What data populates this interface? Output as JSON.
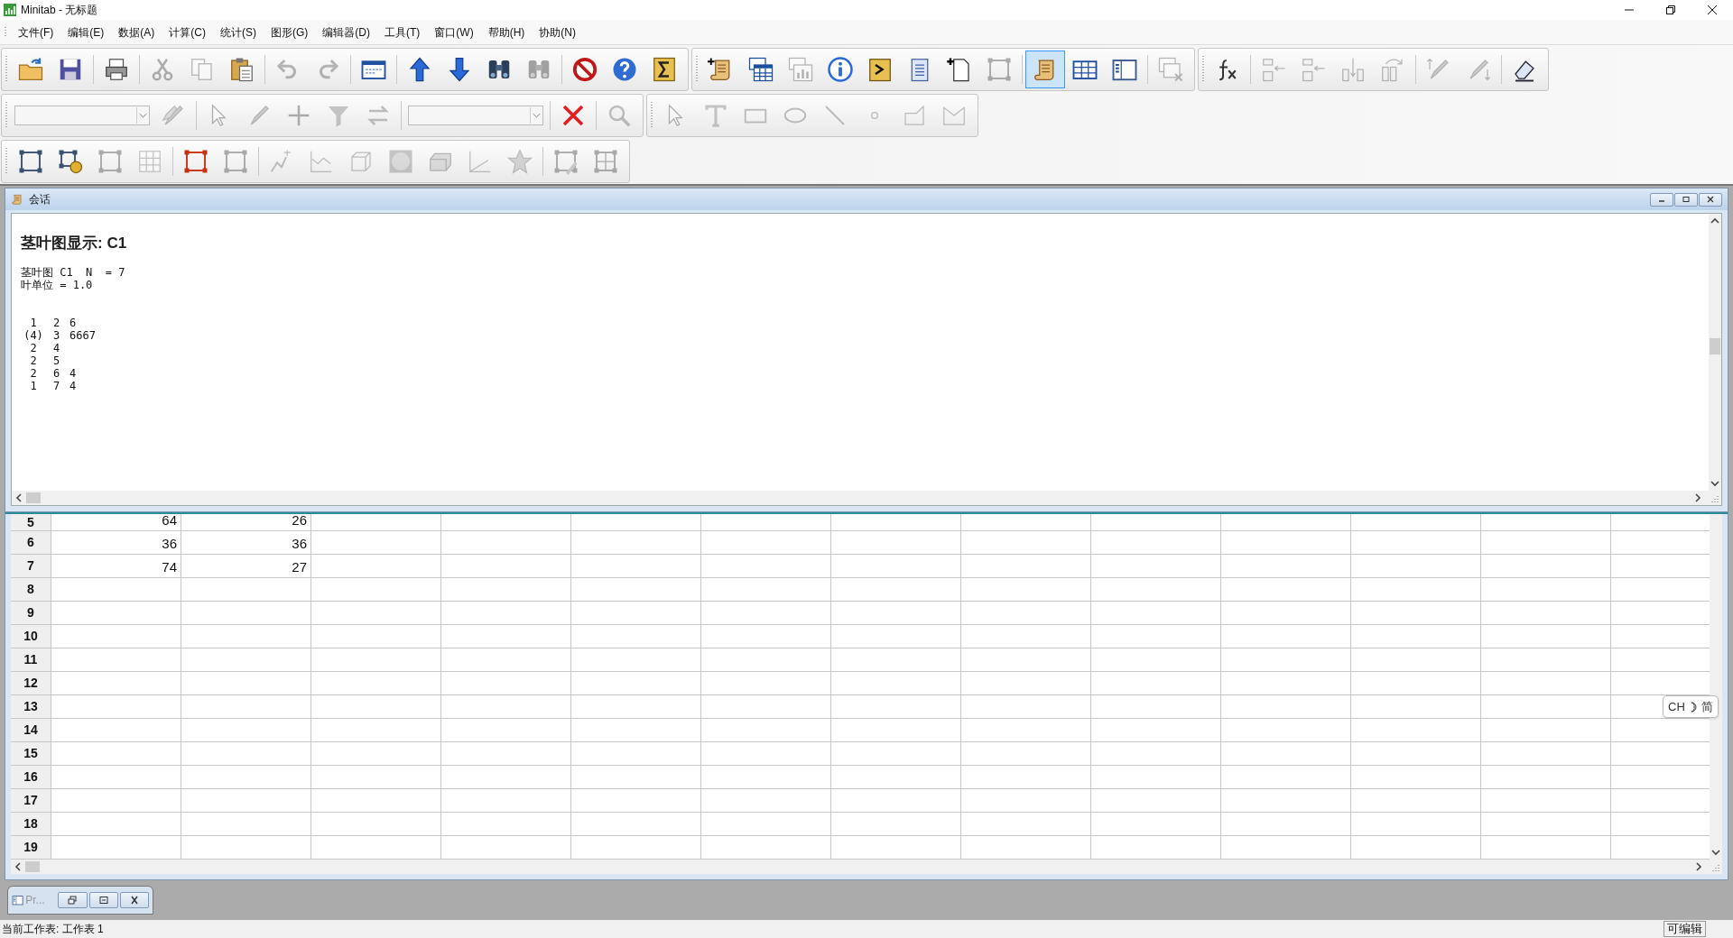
{
  "window": {
    "title": "Minitab - 无标题"
  },
  "menu": [
    "文件(F)",
    "编辑(E)",
    "数据(A)",
    "计算(C)",
    "统计(S)",
    "图形(G)",
    "编辑器(D)",
    "工具(T)",
    "窗口(W)",
    "帮助(H)",
    "协助(N)"
  ],
  "toolbar_rows": [
    [
      {
        "sections": [
          [
            {
              "kind": "folder",
              "disabled": false,
              "on": false
            },
            {
              "kind": "floppy",
              "disabled": false,
              "on": false
            }
          ],
          [
            {
              "kind": "printer",
              "disabled": false,
              "on": false
            }
          ],
          [
            {
              "kind": "scissors",
              "disabled": true,
              "on": false
            },
            {
              "kind": "copy",
              "disabled": true,
              "on": false
            },
            {
              "kind": "clipboard",
              "disabled": false,
              "on": false
            }
          ],
          [
            {
              "kind": "undo",
              "disabled": true,
              "on": false
            },
            {
              "kind": "redo",
              "disabled": true,
              "on": false
            }
          ],
          [
            {
              "kind": "dialog",
              "disabled": false,
              "on": false
            }
          ],
          [
            {
              "kind": "uparrow",
              "disabled": false,
              "on": false
            },
            {
              "kind": "downarrow",
              "disabled": false,
              "on": false
            },
            {
              "kind": "binoculars",
              "disabled": false,
              "on": false
            },
            {
              "kind": "binoculars",
              "disabled": true,
              "on": false
            }
          ],
          [
            {
              "kind": "prohibition",
              "disabled": false,
              "on": false
            },
            {
              "kind": "help",
              "disabled": false,
              "on": false
            },
            {
              "kind": "sigma",
              "disabled": false,
              "on": false
            }
          ]
        ]
      },
      {
        "sections": [
          [
            {
              "kind": "scrollplus",
              "disabled": false,
              "on": false
            },
            {
              "kind": "windowstable",
              "disabled": false,
              "on": false
            },
            {
              "kind": "windowschart",
              "disabled": true,
              "on": false
            },
            {
              "kind": "info",
              "disabled": false,
              "on": false
            },
            {
              "kind": "prompt",
              "disabled": false,
              "on": false
            },
            {
              "kind": "notepad",
              "disabled": false,
              "on": false
            },
            {
              "kind": "newpage",
              "disabled": false,
              "on": false
            },
            {
              "kind": "frame",
              "disabled": true,
              "on": false
            }
          ],
          [
            {
              "kind": "scroll",
              "disabled": false,
              "on": true
            },
            {
              "kind": "table",
              "disabled": false,
              "on": false
            },
            {
              "kind": "panel",
              "disabled": false,
              "on": false
            }
          ],
          [
            {
              "kind": "windowsclose",
              "disabled": true,
              "on": false
            }
          ]
        ]
      },
      {
        "sections": [
          [
            {
              "kind": "function",
              "disabled": false,
              "on": false
            }
          ],
          [
            {
              "kind": "rowinsert",
              "disabled": true,
              "on": false
            },
            {
              "kind": "rowinsert",
              "disabled": true,
              "on": false
            },
            {
              "kind": "columninsert",
              "disabled": true,
              "on": false
            },
            {
              "kind": "columnmove",
              "disabled": true,
              "on": false
            }
          ],
          [
            {
              "kind": "brushup",
              "disabled": true,
              "on": false
            },
            {
              "kind": "brushdown",
              "disabled": true,
              "on": false
            }
          ],
          [
            {
              "kind": "eraser",
              "disabled": false,
              "on": false
            }
          ]
        ]
      }
    ],
    [
      {
        "sections": [
          [
            {
              "kind": "combo",
              "disabled": true
            },
            {
              "kind": "brushes",
              "disabled": true,
              "on": false
            }
          ],
          [
            {
              "kind": "cursor",
              "disabled": true,
              "on": false
            },
            {
              "kind": "brush",
              "disabled": true,
              "on": false
            },
            {
              "kind": "crosshair",
              "disabled": true,
              "on": false
            },
            {
              "kind": "funnel",
              "disabled": true,
              "on": false
            },
            {
              "kind": "swap",
              "disabled": true,
              "on": false
            }
          ],
          [
            {
              "kind": "combo",
              "disabled": true
            }
          ],
          [
            {
              "kind": "cross",
              "disabled": false,
              "on": false
            }
          ],
          [
            {
              "kind": "magnifier",
              "disabled": true,
              "on": false
            }
          ]
        ]
      },
      {
        "sections": [
          [
            {
              "kind": "cursor",
              "disabled": true,
              "on": false
            },
            {
              "kind": "texttool",
              "disabled": true,
              "on": false
            },
            {
              "kind": "rectangle",
              "disabled": true,
              "on": false
            },
            {
              "kind": "ellipse",
              "disabled": true,
              "on": false
            },
            {
              "kind": "line",
              "disabled": true,
              "on": false
            },
            {
              "kind": "dot",
              "disabled": true,
              "on": false
            },
            {
              "kind": "polyline",
              "disabled": true,
              "on": false
            },
            {
              "kind": "polygon",
              "disabled": true,
              "on": false
            }
          ]
        ]
      }
    ],
    [
      {
        "sections": [
          [
            {
              "kind": "frame",
              "disabled": false,
              "on": false
            },
            {
              "kind": "frameplus",
              "disabled": false,
              "on": false
            },
            {
              "kind": "frame",
              "disabled": true,
              "on": false
            },
            {
              "kind": "grid",
              "disabled": true,
              "on": false
            }
          ],
          [
            {
              "kind": "redframe",
              "disabled": false,
              "on": false
            },
            {
              "kind": "frame",
              "disabled": true,
              "on": false
            }
          ],
          [
            {
              "kind": "chartedit",
              "disabled": true,
              "on": false
            },
            {
              "kind": "linechart",
              "disabled": true,
              "on": false
            },
            {
              "kind": "cube",
              "disabled": true,
              "on": false
            },
            {
              "kind": "sphere",
              "disabled": true,
              "on": false
            },
            {
              "kind": "box3d",
              "disabled": true,
              "on": false
            },
            {
              "kind": "axes",
              "disabled": true,
              "on": false
            },
            {
              "kind": "star",
              "disabled": true,
              "on": false
            }
          ],
          [
            {
              "kind": "framebrush",
              "disabled": true,
              "on": false
            },
            {
              "kind": "framegrid",
              "disabled": true,
              "on": false
            }
          ]
        ]
      }
    ]
  ],
  "session": {
    "title": "会话",
    "heading": "茎叶图显示: C1",
    "summary_lines": [
      "茎叶图 C1  N  = 7",
      "叶单位 = 1.0"
    ],
    "stem_leaf_rows": [
      {
        "count": "1",
        "stem": "2",
        "leaves": "6"
      },
      {
        "count": "(4)",
        "stem": "3",
        "leaves": "6667"
      },
      {
        "count": "2",
        "stem": "4"
      },
      {
        "count": "2",
        "stem": "5"
      },
      {
        "count": "2",
        "stem": "6",
        "leaves": "4"
      },
      {
        "count": "1",
        "stem": "7",
        "leaves": "4"
      }
    ]
  },
  "worksheet": {
    "rows": [
      {
        "row": "5",
        "cells": [
          "64",
          "26"
        ]
      },
      {
        "row": "6",
        "cells": [
          "36",
          "36"
        ]
      },
      {
        "row": "7",
        "cells": [
          "74",
          "27"
        ]
      },
      {
        "row": "8"
      },
      {
        "row": "9"
      },
      {
        "row": "10"
      },
      {
        "row": "11"
      },
      {
        "row": "12"
      },
      {
        "row": "13"
      },
      {
        "row": "14"
      },
      {
        "row": "15"
      },
      {
        "row": "16"
      },
      {
        "row": "17"
      },
      {
        "row": "18"
      },
      {
        "row": "19"
      }
    ]
  },
  "ime_indicator": {
    "language": "CH",
    "mode": "简"
  },
  "minimized_window": {
    "title": "Pr..."
  },
  "status_bar": {
    "text": "当前工作表: 工作表 1",
    "mode": "可编辑"
  }
}
